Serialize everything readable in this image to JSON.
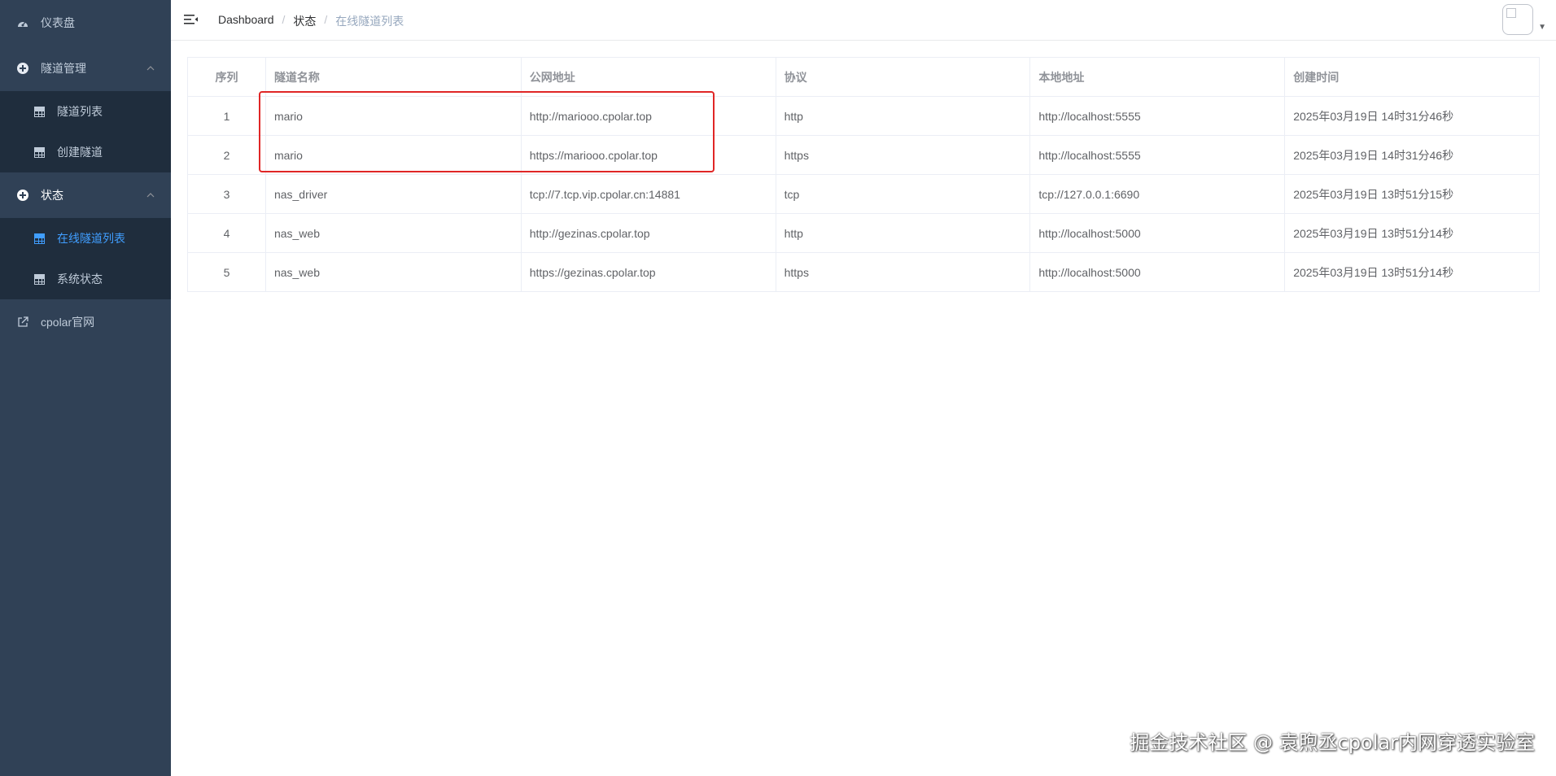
{
  "sidebar": {
    "dashboard": "仪表盘",
    "tunnel_mgmt": "隧道管理",
    "tunnel_list": "隧道列表",
    "create_tunnel": "创建隧道",
    "status": "状态",
    "online_tunnels": "在线隧道列表",
    "system_status": "系统状态",
    "website": "cpolar官网"
  },
  "breadcrumb": [
    "Dashboard",
    "状态",
    "在线隧道列表"
  ],
  "table": {
    "headers": [
      "序列",
      "隧道名称",
      "公网地址",
      "协议",
      "本地地址",
      "创建时间"
    ],
    "rows": [
      [
        "1",
        "mario",
        "http://mariooo.cpolar.top",
        "http",
        "http://localhost:5555",
        "2025年03月19日 14时31分46秒"
      ],
      [
        "2",
        "mario",
        "https://mariooo.cpolar.top",
        "https",
        "http://localhost:5555",
        "2025年03月19日 14时31分46秒"
      ],
      [
        "3",
        "nas_driver",
        "tcp://7.tcp.vip.cpolar.cn:14881",
        "tcp",
        "tcp://127.0.0.1:6690",
        "2025年03月19日 13时51分15秒"
      ],
      [
        "4",
        "nas_web",
        "http://gezinas.cpolar.top",
        "http",
        "http://localhost:5000",
        "2025年03月19日 13时51分14秒"
      ],
      [
        "5",
        "nas_web",
        "https://gezinas.cpolar.top",
        "https",
        "http://localhost:5000",
        "2025年03月19日 13时51分14秒"
      ]
    ]
  },
  "watermark": "掘金技术社区 @ 袁煦丞cpolar内网穿透实验室",
  "colors": {
    "sidebar_bg": "#304156",
    "submenu_bg": "#1f2d3d",
    "active": "#409eff",
    "highlight": "#e02626"
  }
}
